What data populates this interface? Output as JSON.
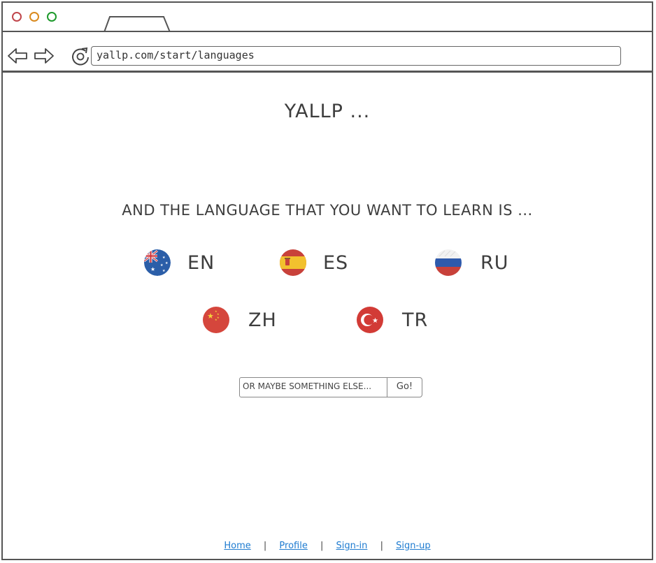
{
  "browser": {
    "url": "yallp.com/start/languages"
  },
  "page": {
    "logo": "YALLP ...",
    "prompt": "AND THE LANGUAGE THAT YOU WANT TO LEARN IS ...",
    "languages": [
      {
        "code": "EN",
        "flag": "australia-flag"
      },
      {
        "code": "ES",
        "flag": "spain-flag"
      },
      {
        "code": "RU",
        "flag": "russia-flag"
      },
      {
        "code": "ZH",
        "flag": "china-flag"
      },
      {
        "code": "TR",
        "flag": "turkey-flag"
      }
    ],
    "search": {
      "placeholder": "OR MAYBE SOMETHING ELSE...",
      "button_label": "Go!"
    }
  },
  "footer": {
    "links": [
      "Home",
      "Profile",
      "Sign-in",
      "Sign-up"
    ],
    "separator": "|"
  },
  "colors": {
    "window_close": "#c0464b",
    "window_minimize": "#d98a1f",
    "window_maximize": "#1e9a2c",
    "link": "#1e7bd0"
  }
}
